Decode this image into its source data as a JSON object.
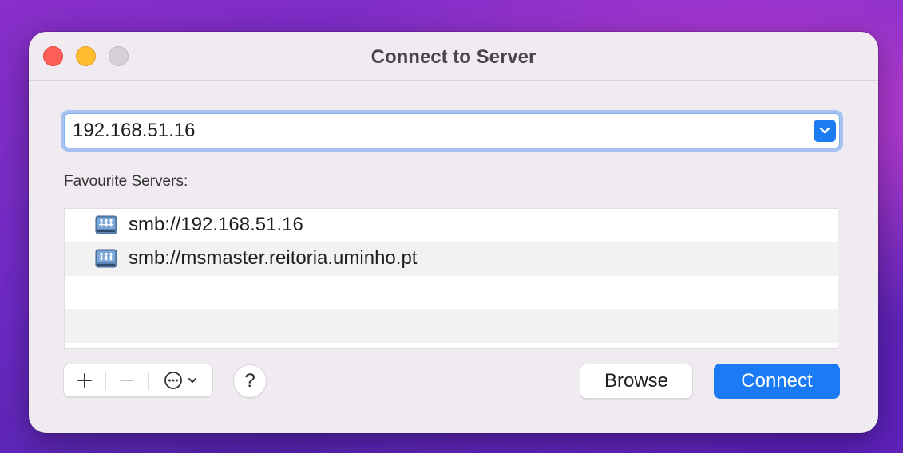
{
  "window": {
    "title": "Connect to Server"
  },
  "address": {
    "value": "192.168.51.16"
  },
  "favourites": {
    "label": "Favourite Servers:",
    "items": [
      {
        "label": "smb://192.168.51.16",
        "icon": "network-server-icon"
      },
      {
        "label": "smb://msmaster.reitoria.uminho.pt",
        "icon": "network-server-icon"
      }
    ]
  },
  "toolbar": {
    "add_icon": "plus-icon",
    "remove_icon": "minus-icon",
    "more_icon": "ellipsis-circle-icon",
    "help_label": "?"
  },
  "buttons": {
    "browse": "Browse",
    "connect": "Connect"
  },
  "colors": {
    "accent": "#1b7bf5",
    "close": "#fe5f57",
    "minimize": "#febc2e",
    "zoom_disabled": "#d6d1d6"
  }
}
